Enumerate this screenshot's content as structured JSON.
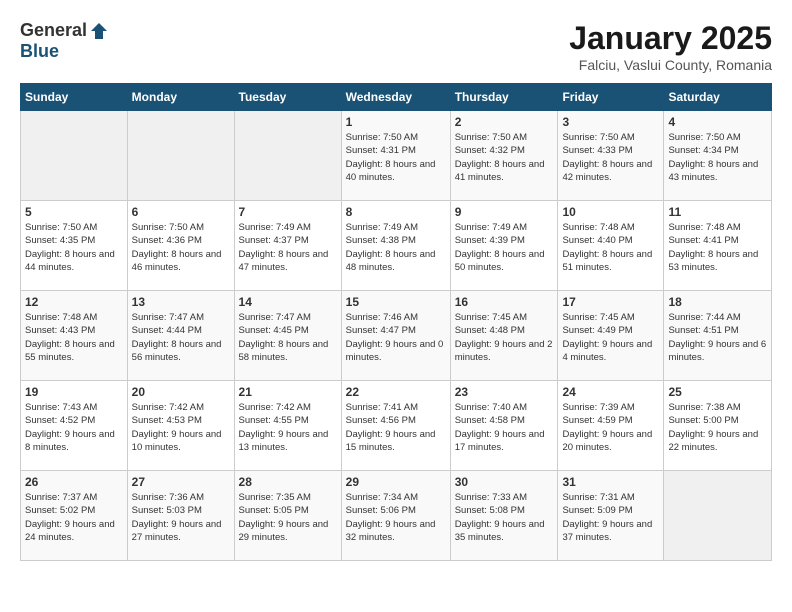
{
  "header": {
    "logo_general": "General",
    "logo_blue": "Blue",
    "month_title": "January 2025",
    "location": "Falciu, Vaslui County, Romania"
  },
  "weekdays": [
    "Sunday",
    "Monday",
    "Tuesday",
    "Wednesday",
    "Thursday",
    "Friday",
    "Saturday"
  ],
  "weeks": [
    [
      {
        "day": "",
        "empty": true
      },
      {
        "day": "",
        "empty": true
      },
      {
        "day": "",
        "empty": true
      },
      {
        "day": "1",
        "sunrise": "Sunrise: 7:50 AM",
        "sunset": "Sunset: 4:31 PM",
        "daylight": "Daylight: 8 hours and 40 minutes."
      },
      {
        "day": "2",
        "sunrise": "Sunrise: 7:50 AM",
        "sunset": "Sunset: 4:32 PM",
        "daylight": "Daylight: 8 hours and 41 minutes."
      },
      {
        "day": "3",
        "sunrise": "Sunrise: 7:50 AM",
        "sunset": "Sunset: 4:33 PM",
        "daylight": "Daylight: 8 hours and 42 minutes."
      },
      {
        "day": "4",
        "sunrise": "Sunrise: 7:50 AM",
        "sunset": "Sunset: 4:34 PM",
        "daylight": "Daylight: 8 hours and 43 minutes."
      }
    ],
    [
      {
        "day": "5",
        "sunrise": "Sunrise: 7:50 AM",
        "sunset": "Sunset: 4:35 PM",
        "daylight": "Daylight: 8 hours and 44 minutes."
      },
      {
        "day": "6",
        "sunrise": "Sunrise: 7:50 AM",
        "sunset": "Sunset: 4:36 PM",
        "daylight": "Daylight: 8 hours and 46 minutes."
      },
      {
        "day": "7",
        "sunrise": "Sunrise: 7:49 AM",
        "sunset": "Sunset: 4:37 PM",
        "daylight": "Daylight: 8 hours and 47 minutes."
      },
      {
        "day": "8",
        "sunrise": "Sunrise: 7:49 AM",
        "sunset": "Sunset: 4:38 PM",
        "daylight": "Daylight: 8 hours and 48 minutes."
      },
      {
        "day": "9",
        "sunrise": "Sunrise: 7:49 AM",
        "sunset": "Sunset: 4:39 PM",
        "daylight": "Daylight: 8 hours and 50 minutes."
      },
      {
        "day": "10",
        "sunrise": "Sunrise: 7:48 AM",
        "sunset": "Sunset: 4:40 PM",
        "daylight": "Daylight: 8 hours and 51 minutes."
      },
      {
        "day": "11",
        "sunrise": "Sunrise: 7:48 AM",
        "sunset": "Sunset: 4:41 PM",
        "daylight": "Daylight: 8 hours and 53 minutes."
      }
    ],
    [
      {
        "day": "12",
        "sunrise": "Sunrise: 7:48 AM",
        "sunset": "Sunset: 4:43 PM",
        "daylight": "Daylight: 8 hours and 55 minutes."
      },
      {
        "day": "13",
        "sunrise": "Sunrise: 7:47 AM",
        "sunset": "Sunset: 4:44 PM",
        "daylight": "Daylight: 8 hours and 56 minutes."
      },
      {
        "day": "14",
        "sunrise": "Sunrise: 7:47 AM",
        "sunset": "Sunset: 4:45 PM",
        "daylight": "Daylight: 8 hours and 58 minutes."
      },
      {
        "day": "15",
        "sunrise": "Sunrise: 7:46 AM",
        "sunset": "Sunset: 4:47 PM",
        "daylight": "Daylight: 9 hours and 0 minutes."
      },
      {
        "day": "16",
        "sunrise": "Sunrise: 7:45 AM",
        "sunset": "Sunset: 4:48 PM",
        "daylight": "Daylight: 9 hours and 2 minutes."
      },
      {
        "day": "17",
        "sunrise": "Sunrise: 7:45 AM",
        "sunset": "Sunset: 4:49 PM",
        "daylight": "Daylight: 9 hours and 4 minutes."
      },
      {
        "day": "18",
        "sunrise": "Sunrise: 7:44 AM",
        "sunset": "Sunset: 4:51 PM",
        "daylight": "Daylight: 9 hours and 6 minutes."
      }
    ],
    [
      {
        "day": "19",
        "sunrise": "Sunrise: 7:43 AM",
        "sunset": "Sunset: 4:52 PM",
        "daylight": "Daylight: 9 hours and 8 minutes."
      },
      {
        "day": "20",
        "sunrise": "Sunrise: 7:42 AM",
        "sunset": "Sunset: 4:53 PM",
        "daylight": "Daylight: 9 hours and 10 minutes."
      },
      {
        "day": "21",
        "sunrise": "Sunrise: 7:42 AM",
        "sunset": "Sunset: 4:55 PM",
        "daylight": "Daylight: 9 hours and 13 minutes."
      },
      {
        "day": "22",
        "sunrise": "Sunrise: 7:41 AM",
        "sunset": "Sunset: 4:56 PM",
        "daylight": "Daylight: 9 hours and 15 minutes."
      },
      {
        "day": "23",
        "sunrise": "Sunrise: 7:40 AM",
        "sunset": "Sunset: 4:58 PM",
        "daylight": "Daylight: 9 hours and 17 minutes."
      },
      {
        "day": "24",
        "sunrise": "Sunrise: 7:39 AM",
        "sunset": "Sunset: 4:59 PM",
        "daylight": "Daylight: 9 hours and 20 minutes."
      },
      {
        "day": "25",
        "sunrise": "Sunrise: 7:38 AM",
        "sunset": "Sunset: 5:00 PM",
        "daylight": "Daylight: 9 hours and 22 minutes."
      }
    ],
    [
      {
        "day": "26",
        "sunrise": "Sunrise: 7:37 AM",
        "sunset": "Sunset: 5:02 PM",
        "daylight": "Daylight: 9 hours and 24 minutes."
      },
      {
        "day": "27",
        "sunrise": "Sunrise: 7:36 AM",
        "sunset": "Sunset: 5:03 PM",
        "daylight": "Daylight: 9 hours and 27 minutes."
      },
      {
        "day": "28",
        "sunrise": "Sunrise: 7:35 AM",
        "sunset": "Sunset: 5:05 PM",
        "daylight": "Daylight: 9 hours and 29 minutes."
      },
      {
        "day": "29",
        "sunrise": "Sunrise: 7:34 AM",
        "sunset": "Sunset: 5:06 PM",
        "daylight": "Daylight: 9 hours and 32 minutes."
      },
      {
        "day": "30",
        "sunrise": "Sunrise: 7:33 AM",
        "sunset": "Sunset: 5:08 PM",
        "daylight": "Daylight: 9 hours and 35 minutes."
      },
      {
        "day": "31",
        "sunrise": "Sunrise: 7:31 AM",
        "sunset": "Sunset: 5:09 PM",
        "daylight": "Daylight: 9 hours and 37 minutes."
      },
      {
        "day": "",
        "empty": true
      }
    ]
  ]
}
